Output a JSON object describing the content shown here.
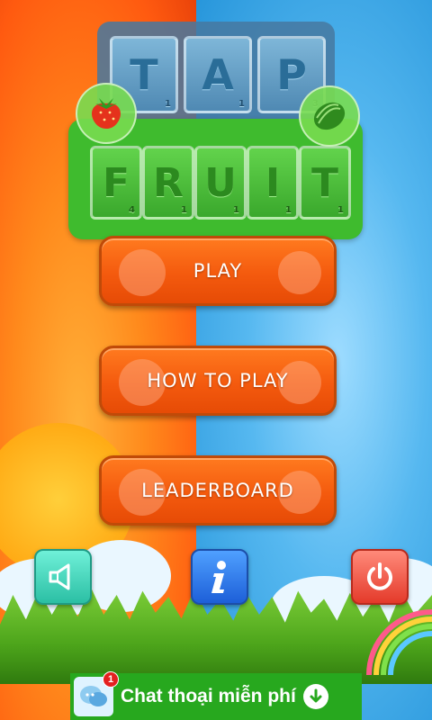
{
  "logo": {
    "tap_letters": [
      {
        "letter": "T",
        "score": "1"
      },
      {
        "letter": "A",
        "score": "1"
      },
      {
        "letter": "P",
        "score": "3"
      }
    ],
    "fruit_letters": [
      {
        "letter": "F",
        "score": "4"
      },
      {
        "letter": "R",
        "score": "1"
      },
      {
        "letter": "U",
        "score": "1"
      },
      {
        "letter": "I",
        "score": "1"
      },
      {
        "letter": "T",
        "score": "1"
      }
    ]
  },
  "menu": {
    "play": "PLAY",
    "how_to_play": "HOW TO PLAY",
    "leaderboard": "LEADERBOARD"
  },
  "controls": {
    "sound_icon": "speaker-icon",
    "info_icon": "info-icon",
    "power_icon": "power-icon"
  },
  "ad": {
    "text": "Chat thoại miễn phí",
    "badge_count": "1"
  },
  "colors": {
    "left_bg": "#ff6a12",
    "right_bg": "#3aa6e6",
    "button": "#f45a0e",
    "fruit_banner": "#3fbb2e",
    "ad_bg": "#27a81e"
  }
}
